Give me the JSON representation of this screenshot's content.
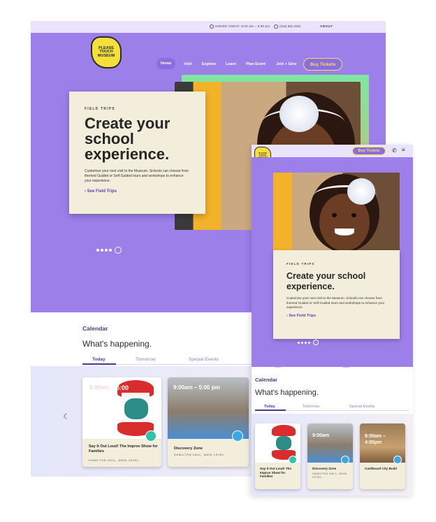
{
  "desktop": {
    "topbar": {
      "hours": "HOURS TODAY: 9:00 am – 5:00 pm",
      "phone": "(215) 581.3181",
      "about": "ABOUT"
    },
    "logo_text": "PLEASE TOUCH MUSEUM",
    "nav": [
      "Home",
      "Visit",
      "Explore",
      "Learn",
      "Plan Event",
      "Join + Give"
    ],
    "buy_tickets": "Buy Tickets",
    "hero": {
      "eyebrow": "FIELD TRIPS",
      "headline": "Create your school experience.",
      "body": "Customize your next visit to the Museum. Schools can choose from themed Guided or Self-Guided tours and workshops to enhance your experience.",
      "link": "› See Field Trips",
      "carousel_index": 5,
      "carousel_count": 5
    },
    "calendar": {
      "title": "Calendar",
      "subtitle": "What's happening.",
      "tabs": [
        "Today",
        "Tomorrow",
        "Special Events"
      ],
      "events": [
        {
          "time": "5:00",
          "time_ghost": "8:00am",
          "title": "Say It Out Loud! The Improv Show for Families",
          "location": "HAMILTON HALL, MAIN LEVEL",
          "icon": "theater-masks-icon"
        },
        {
          "time": "9:00am – 5:00 pm",
          "title": "Discovery Zone",
          "location": "HAMILTON HALL, MAIN LEVEL",
          "icon": "cube-icon"
        }
      ]
    }
  },
  "mobile": {
    "logo_text": "PLEASE TOUCH MUSEUM",
    "buy_tickets": "Buy Tickets",
    "hero": {
      "eyebrow": "FIELD TRIPS",
      "headline": "Create your school experience.",
      "body": "Customize your next visit to the Museum. Schools can choose from themed Guided or Self-Guided tours and workshops to enhance your experience.",
      "link": "› See Field Trips"
    },
    "calendar": {
      "title": "Calendar",
      "subtitle": "What's happening.",
      "tabs": [
        "Today",
        "Tomorrow",
        "Special Events"
      ],
      "events": [
        {
          "title": "Say It Out Loud! The Improv Show for Families",
          "icon": "theater-masks-icon"
        },
        {
          "time": "9:00am",
          "title": "Discovery Zone",
          "location": "HAMILTON HALL, MAIN LEVEL",
          "icon": "cube-icon"
        },
        {
          "time": "9:00am – 4:00pm",
          "title": "Cardboard City Build",
          "icon": "cube-icon"
        }
      ]
    }
  },
  "colors": {
    "hero_purple": "#9c7fe9",
    "topbar_lavender": "#e9e3fb",
    "card_cream": "#f2eedb",
    "accent_yellow": "#f7e44a",
    "link_purple": "#5c43b8",
    "badge_teal": "#2ec4a9",
    "badge_blue": "#3aa7e0"
  }
}
